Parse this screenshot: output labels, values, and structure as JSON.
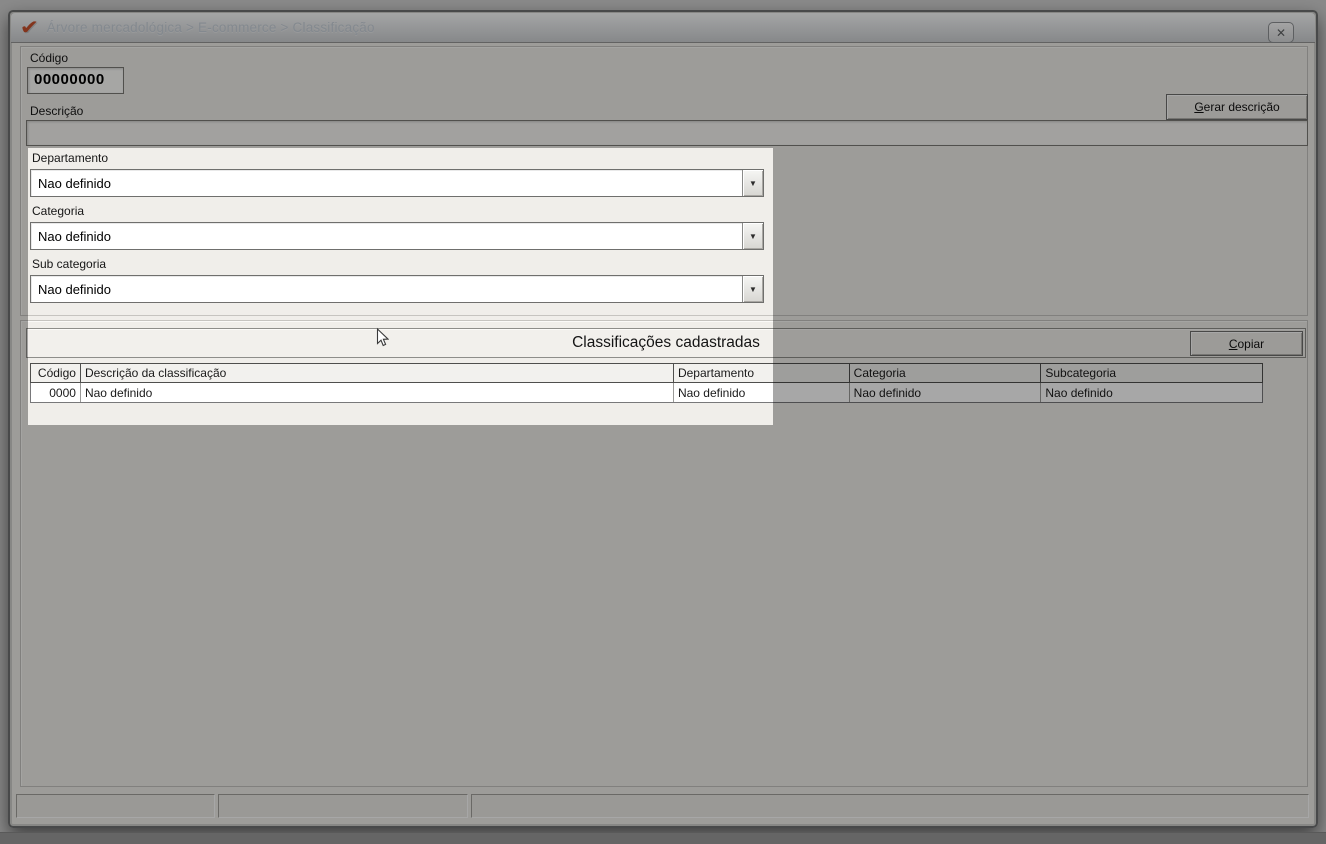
{
  "window": {
    "title": "Árvore mercadológica > E-commerce > Classificação"
  },
  "icons": {
    "logo_glyph": "✔",
    "close_glyph": "✕",
    "dropdown_glyph": "▼"
  },
  "form": {
    "codigo_label": "Código",
    "codigo_value": "00000000",
    "descricao_label": "Descrição",
    "descricao_value": "",
    "gerar_button": {
      "accel": "G",
      "rest": "erar descrição"
    },
    "dropdowns": [
      {
        "label": "Departamento",
        "value": "Nao definido"
      },
      {
        "label": "Categoria",
        "value": "Nao definido"
      },
      {
        "label": "Sub categoria",
        "value": "Nao definido"
      }
    ]
  },
  "classificacoes": {
    "title": "Classificações cadastradas",
    "copiar_button": {
      "accel": "C",
      "rest": "opiar"
    },
    "table": {
      "columns": [
        "Código",
        "Descrição da classificação",
        "Departamento",
        "Categoria",
        "Subcategoria"
      ],
      "rows": [
        [
          "0000",
          "Nao definido",
          "Nao definido",
          "Nao definido",
          "Nao definido"
        ]
      ]
    }
  },
  "statusbar": {
    "cells": [
      "",
      "",
      ""
    ]
  },
  "colors": {
    "accent_orange": "#c9502b",
    "window_bg": "#f0eeea",
    "dim_overlay": "rgba(0,0,0,0.345)"
  }
}
